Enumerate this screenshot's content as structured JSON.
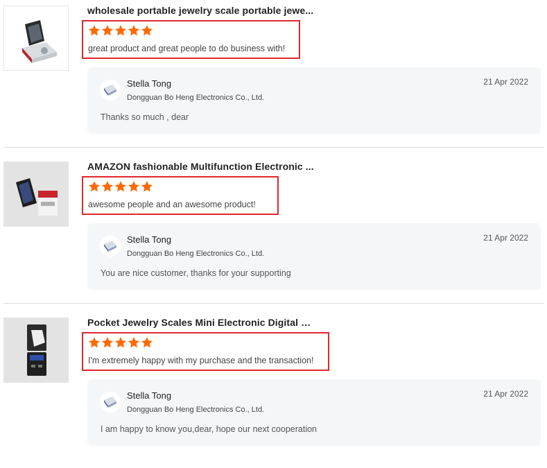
{
  "reviews": [
    {
      "product_title": "wholesale portable jewelry scale portable jewe...",
      "rating": 5,
      "text": "great product and great people to do business with!",
      "reply": {
        "name": "Stella Tong",
        "company": "Dongguan Bo Heng Electronics Co., Ltd.",
        "date": "21 Apr 2022",
        "text": "Thanks so much , dear"
      }
    },
    {
      "product_title": "AMAZON fashionable Multifunction Electronic ...",
      "rating": 5,
      "text": "awesome people and an awesome product!",
      "reply": {
        "name": "Stella Tong",
        "company": "Dongguan Bo Heng Electronics Co., Ltd.",
        "date": "21 Apr 2022",
        "text": "You are nice customer, thanks for your supporting"
      }
    },
    {
      "product_title": "Pocket Jewelry Scales Mini Electronic Digital G...",
      "rating": 5,
      "text": "I'm extremely happy with my purchase and the transaction!",
      "reply": {
        "name": "Stella Tong",
        "company": "Dongguan Bo Heng Electronics Co., Ltd.",
        "date": "21 Apr 2022",
        "text": "I am happy to know you,dear, hope our next cooperation"
      }
    }
  ],
  "icons": {
    "star": "star-icon",
    "avatar": "supplier-logo"
  },
  "colors": {
    "star": "#ff6a00",
    "highlight_border": "#e0262b",
    "reply_bg": "#f5f6f7"
  }
}
